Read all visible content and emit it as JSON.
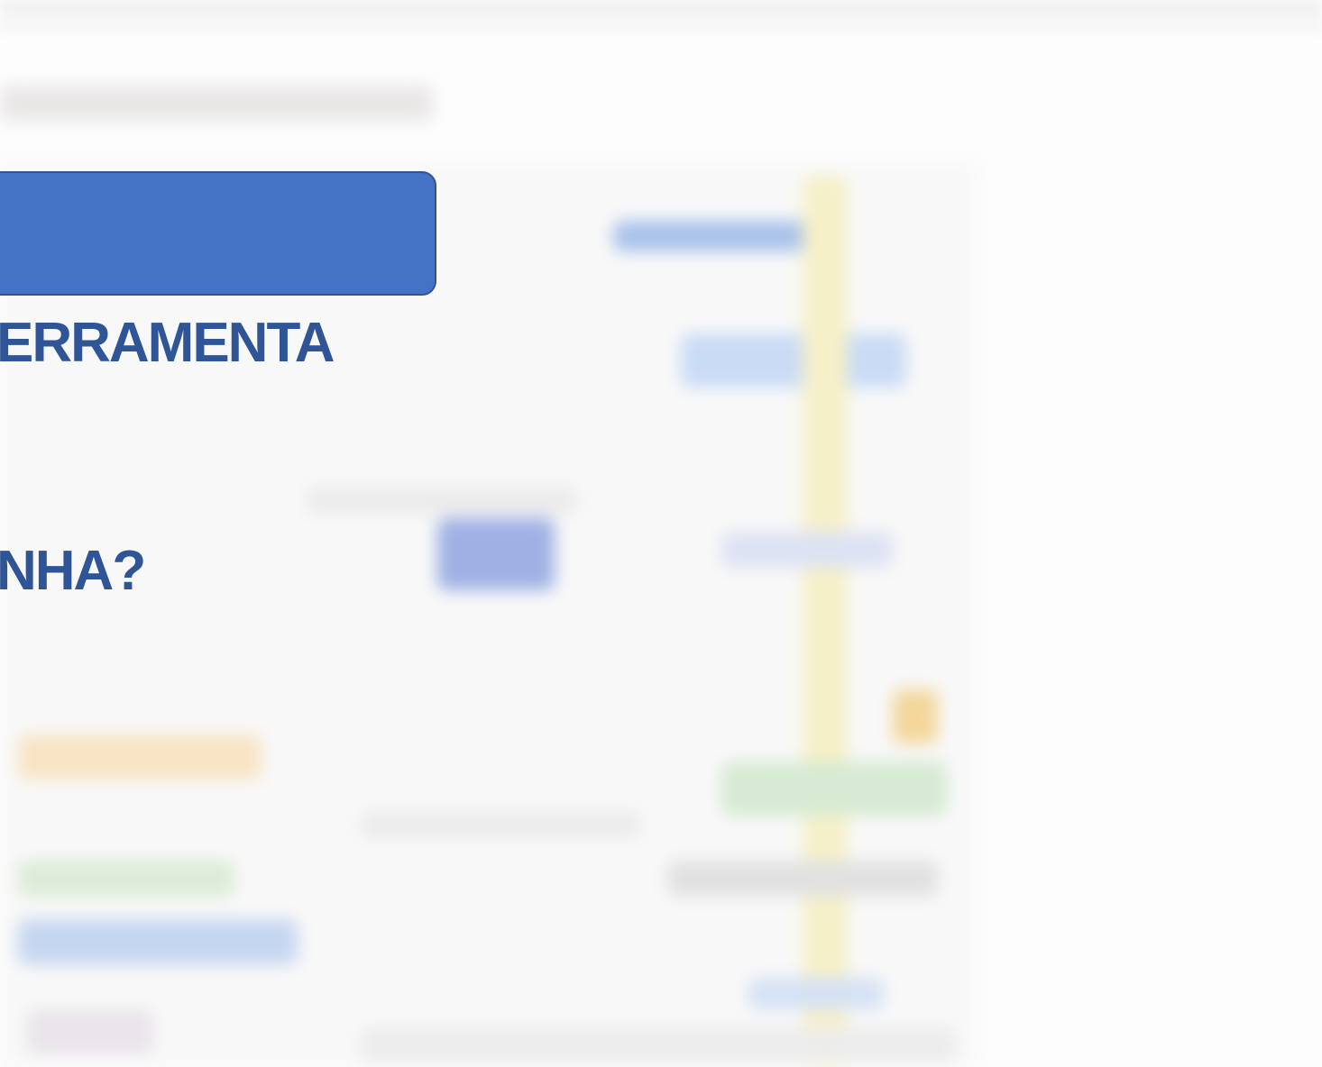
{
  "slide": {
    "heading_1": "ERRAMENTA",
    "heading_2": "NHA?"
  },
  "colors": {
    "banner_fill": "#4472c4",
    "banner_border": "#2f5597",
    "heading_text": "#2f5597"
  }
}
